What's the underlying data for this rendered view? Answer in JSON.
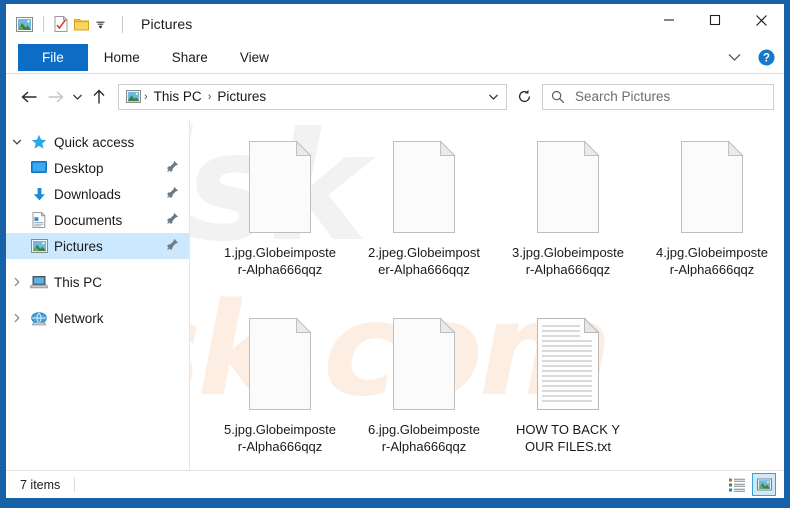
{
  "window": {
    "title": "Pictures",
    "quick_access_toolbar": [
      {
        "name": "pictures-library-icon",
        "label": "Pictures library"
      },
      {
        "name": "properties-icon",
        "label": "Properties"
      },
      {
        "name": "new-folder-icon",
        "label": "New folder"
      },
      {
        "name": "customize-dropdown-icon",
        "label": "Customize Quick Access Toolbar"
      }
    ],
    "controls": {
      "minimize": "—",
      "maximize": "☐",
      "close": "✕"
    }
  },
  "ribbon": {
    "tabs": [
      {
        "label": "File",
        "selected": true
      },
      {
        "label": "Home",
        "selected": false
      },
      {
        "label": "Share",
        "selected": false
      },
      {
        "label": "View",
        "selected": false
      }
    ],
    "expand_label": "Expand the Ribbon",
    "help_label": "?"
  },
  "address": {
    "back_label": "Back",
    "forward_label": "Forward",
    "history_label": "Recent locations",
    "up_label": "Up",
    "breadcrumbs": [
      "This PC",
      "Pictures"
    ],
    "separator": "›",
    "dropdown_label": "Previous locations",
    "refresh_label": "Refresh"
  },
  "search": {
    "placeholder": "Search Pictures",
    "value": ""
  },
  "sidebar": {
    "items": [
      {
        "label": "Quick access",
        "icon": "star-icon",
        "chevron": "expanded",
        "indent": false,
        "pinned": false,
        "selected": false
      },
      {
        "label": "Desktop",
        "icon": "desktop-icon",
        "chevron": "none",
        "indent": true,
        "pinned": true,
        "selected": false
      },
      {
        "label": "Downloads",
        "icon": "downloads-icon",
        "chevron": "none",
        "indent": true,
        "pinned": true,
        "selected": false
      },
      {
        "label": "Documents",
        "icon": "documents-icon",
        "chevron": "none",
        "indent": true,
        "pinned": true,
        "selected": false
      },
      {
        "label": "Pictures",
        "icon": "pictures-icon",
        "chevron": "none",
        "indent": true,
        "pinned": true,
        "selected": true
      },
      {
        "label": "This PC",
        "icon": "this-pc-icon",
        "chevron": "collapsed",
        "indent": false,
        "pinned": false,
        "selected": false
      },
      {
        "label": "Network",
        "icon": "network-icon",
        "chevron": "collapsed",
        "indent": false,
        "pinned": false,
        "selected": false
      }
    ]
  },
  "files": [
    {
      "name": "1.jpg.Globeimposter-Alpha666qqz",
      "icon": "blank-document-icon"
    },
    {
      "name": "2.jpeg.Globeimposter-Alpha666qqz",
      "icon": "blank-document-icon"
    },
    {
      "name": "3.jpg.Globeimposter-Alpha666qqz",
      "icon": "blank-document-icon"
    },
    {
      "name": "4.jpg.Globeimposter-Alpha666qqz",
      "icon": "blank-document-icon"
    },
    {
      "name": "5.jpg.Globeimposter-Alpha666qqz",
      "icon": "blank-document-icon"
    },
    {
      "name": "6.jpg.Globeimposter-Alpha666qqz",
      "icon": "blank-document-icon"
    },
    {
      "name": "HOW TO BACK YOUR FILES.txt",
      "icon": "text-document-icon"
    }
  ],
  "status": {
    "count_text": "7 items",
    "details_view_label": "Details view",
    "large_icons_view_label": "Large icons view"
  },
  "watermark": {
    "top_text": "risk",
    "bottom_text": "risk.com"
  },
  "colors": {
    "frame": "#1661a8",
    "accent_tab": "#0d6dc4",
    "selection": "#cce8ff",
    "watermark_warm": "#fdeee4",
    "watermark_grey": "#f2f2f2"
  }
}
